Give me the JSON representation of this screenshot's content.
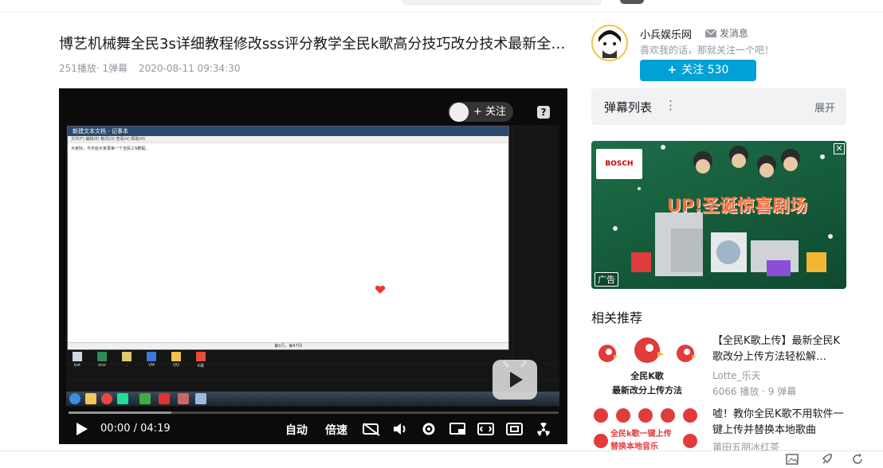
{
  "video": {
    "title": "博艺机械舞全民3s详细教程修改sss评分教学全民k歌高分技巧改分技术最新全…",
    "plays": "251播放",
    "danmaku_count": "· 1弹幕",
    "date": "2020-08-11 09:34:30"
  },
  "player": {
    "follow_label": "关注",
    "help_label": "?",
    "current_time": "00:00",
    "separator": "/",
    "duration": "04:19",
    "auto_label": "自动",
    "speed_label": "倍速",
    "progress_buffered": 0.21,
    "inner_window_text": "大家好，今天给大家录第一个全民三S教程。",
    "inner_status": "第1行，第47列"
  },
  "uploader": {
    "name": "小兵娱乐网",
    "message_label": "发消息",
    "signature": "喜欢我的话，那就关注一个吧！",
    "follow_button": "关注 530"
  },
  "danmaku_panel": {
    "title": "弹幕列表",
    "more": "⋮",
    "expand": "展开"
  },
  "ad": {
    "brand": "BOSCH",
    "tag": "广告",
    "headline": "UP!圣诞惊喜剧场",
    "close": "✕"
  },
  "related": {
    "heading": "相关推荐",
    "items": [
      {
        "title": "【全民K歌上传】最新全民K歌改分上传方法轻松解…",
        "author": "Lotte_乐天",
        "stats": "6066 播放 · 9 弹幕",
        "thumb_text_1": "全民K歌",
        "thumb_text_2": "最新改分上传方法"
      },
      {
        "title": "嘘！教你全民K歌不用软件一键上传并替换本地歌曲",
        "author": "莆田五朋冰红茶",
        "thumb_text_1": "全民k歌一键上传",
        "thumb_text_2": "替换本地音乐"
      }
    ]
  },
  "colors": {
    "accent": "#00a1d6",
    "player_bg": "#0b0b0b",
    "ad_bg": "#1d6e47"
  }
}
